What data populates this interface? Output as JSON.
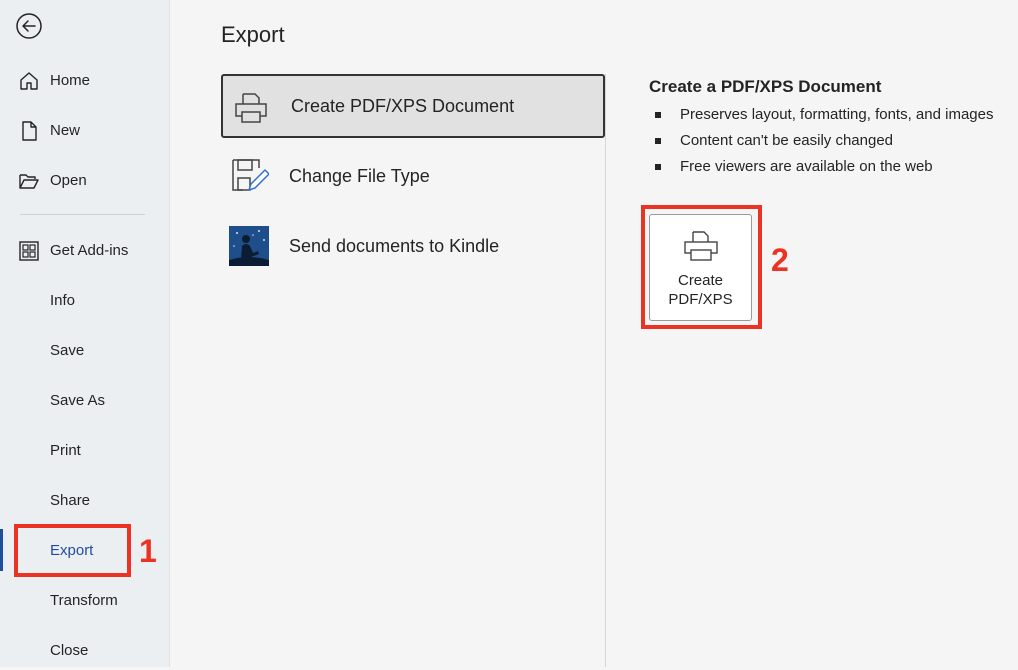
{
  "sidebar": {
    "items": [
      {
        "label": "Home",
        "icon": "home-icon"
      },
      {
        "label": "New",
        "icon": "new-document-icon"
      },
      {
        "label": "Open",
        "icon": "folder-open-icon"
      },
      {
        "label": "Get Add-ins",
        "icon": "add-ins-grid-icon"
      },
      {
        "label": "Info"
      },
      {
        "label": "Save"
      },
      {
        "label": "Save As"
      },
      {
        "label": "Print"
      },
      {
        "label": "Share"
      },
      {
        "label": "Export",
        "active": true
      },
      {
        "label": "Transform"
      },
      {
        "label": "Close"
      }
    ]
  },
  "page": {
    "title": "Export"
  },
  "options": [
    {
      "label": "Create PDF/XPS Document",
      "icon": "printer-document-icon",
      "selected": true
    },
    {
      "label": "Change File Type",
      "icon": "file-type-edit-icon"
    },
    {
      "label": "Send documents to Kindle",
      "icon": "kindle-reader-icon"
    }
  ],
  "detail": {
    "title": "Create a PDF/XPS Document",
    "bullets": [
      "Preserves layout, formatting, fonts, and images",
      "Content can't be easily changed",
      "Free viewers are available on the web"
    ],
    "button": {
      "line1": "Create",
      "line2": "PDF/XPS",
      "icon": "printer-document-icon"
    }
  },
  "annotations": {
    "step1": "1",
    "step2": "2",
    "color": "#ea3323"
  },
  "colors": {
    "accent": "#1e4e9c",
    "sidebar_bg": "#eceff2",
    "main_bg": "#f5f5f5"
  }
}
